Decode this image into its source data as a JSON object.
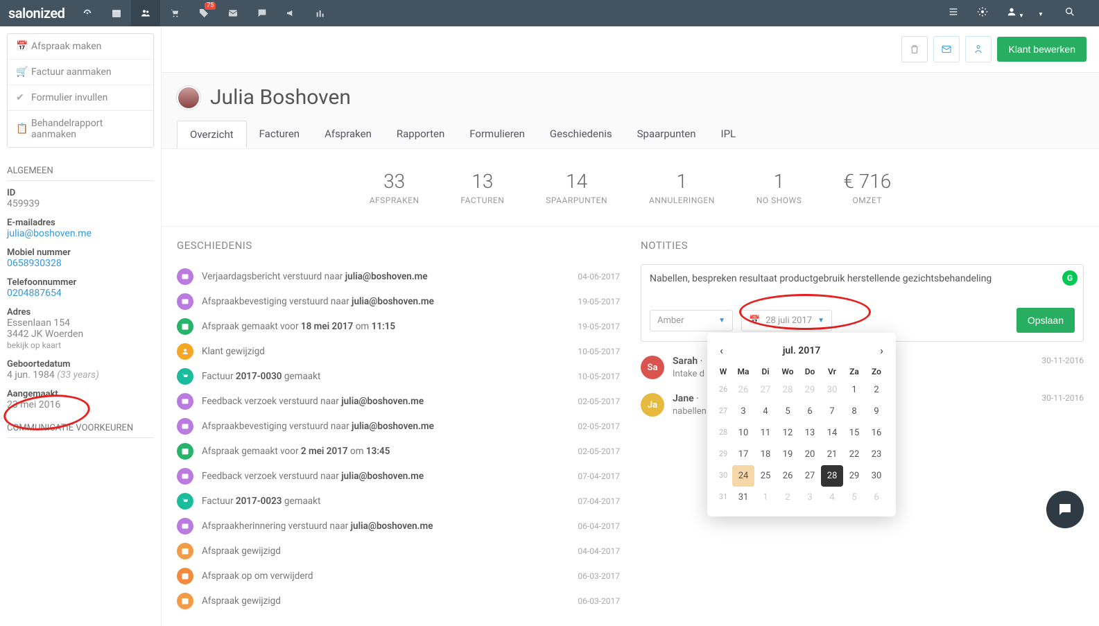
{
  "topnav": {
    "logo": "salonized",
    "tag_badge": "75"
  },
  "actionbar": {
    "edit_label": "Klant bewerken"
  },
  "sidebar": {
    "actions": [
      "Afspraak maken",
      "Factuur aanmaken",
      "Formulier invullen",
      "Behandelrapport aanmaken"
    ],
    "section_general": "ALGEMEEN",
    "id_label": "ID",
    "id_value": "459939",
    "email_label": "E-mailadres",
    "email_value": "julia@boshoven.me",
    "mobile_label": "Mobiel nummer",
    "mobile_value": "0658930328",
    "phone_label": "Telefoonnummer",
    "phone_value": "0204887654",
    "address_label": "Adres",
    "address_line1": "Essenlaan 154",
    "address_line2": "3442 JK Woerden",
    "address_map": "bekijk op kaart",
    "dob_label": "Geboortedatum",
    "dob_value": "4 jun. 1984",
    "dob_age": "(33 years)",
    "created_label": "Aangemaakt",
    "created_value": "23 mei 2016",
    "section_comm": "COMMUNICATIE VOORKEUREN"
  },
  "client": {
    "name": "Julia Boshoven"
  },
  "tabs": [
    "Overzicht",
    "Facturen",
    "Afspraken",
    "Rapporten",
    "Formulieren",
    "Geschiedenis",
    "Spaarpunten",
    "IPL"
  ],
  "stats": [
    {
      "val": "33",
      "lbl": "AFSPRAKEN"
    },
    {
      "val": "13",
      "lbl": "FACTUREN"
    },
    {
      "val": "14",
      "lbl": "SPAARPUNTEN"
    },
    {
      "val": "1",
      "lbl": "ANNULERINGEN"
    },
    {
      "val": "1",
      "lbl": "NO SHOWS"
    },
    {
      "val": "€ 716",
      "lbl": "OMZET"
    }
  ],
  "history": {
    "title": "GESCHIEDENIS",
    "items": [
      {
        "icon": "mail",
        "color": "hi-purple",
        "html": "Verjaardagsbericht verstuurd naar <b>julia@boshoven.me</b>",
        "date": "04-06-2017"
      },
      {
        "icon": "mail",
        "color": "hi-purple",
        "html": "Afspraakbevestiging verstuurd naar <b>julia@boshoven.me</b>",
        "date": "19-05-2017"
      },
      {
        "icon": "cal",
        "color": "hi-green",
        "html": "Afspraak gemaakt voor <b>18 mei 2017</b> om <b>11:15</b>",
        "date": "19-05-2017"
      },
      {
        "icon": "user",
        "color": "hi-orange",
        "html": "Klant gewijzigd",
        "date": "10-05-2017"
      },
      {
        "icon": "cart",
        "color": "hi-teal",
        "html": "Factuur <b>2017-0030</b> gemaakt",
        "date": "10-05-2017"
      },
      {
        "icon": "mail",
        "color": "hi-purple",
        "html": "Feedback verzoek verstuurd naar <b>julia@boshoven.me</b>",
        "date": "02-05-2017"
      },
      {
        "icon": "mail",
        "color": "hi-purple",
        "html": "Afspraakbevestiging verstuurd naar <b>julia@boshoven.me</b>",
        "date": "02-05-2017"
      },
      {
        "icon": "cal",
        "color": "hi-green",
        "html": "Afspraak gemaakt voor <b>2 mei 2017</b> om <b>13:45</b>",
        "date": "02-05-2017"
      },
      {
        "icon": "mail",
        "color": "hi-purple",
        "html": "Feedback verzoek verstuurd naar <b>julia@boshoven.me</b>",
        "date": "07-04-2017"
      },
      {
        "icon": "cart",
        "color": "hi-teal",
        "html": "Factuur <b>2017-0023</b> gemaakt",
        "date": "07-04-2017"
      },
      {
        "icon": "mail",
        "color": "hi-purple",
        "html": "Afspraakherinnering verstuurd naar <b>julia@boshoven.me</b>",
        "date": "06-04-2017"
      },
      {
        "icon": "cal",
        "color": "hi-orange2",
        "html": "Afspraak gewijzigd",
        "date": "04-04-2017"
      },
      {
        "icon": "cal",
        "color": "hi-orange3",
        "html": "Afspraak op om verwijderd",
        "date": "06-03-2017"
      },
      {
        "icon": "cal",
        "color": "hi-orange2",
        "html": "Afspraak gewijzigd",
        "date": "06-03-2017"
      }
    ]
  },
  "notes": {
    "title": "NOTITIES",
    "draft": "Nabellen, bespreken resultaat productgebruik herstellende gezichtsbehandeling",
    "assignee": "Amber",
    "date_label": "28 juli 2017",
    "save_label": "Opslaan",
    "items": [
      {
        "initials": "Sa",
        "color": "na-red",
        "author": "Sarah",
        "msg": "Intake d",
        "date": "30-11-2016"
      },
      {
        "initials": "Ja",
        "color": "na-yellow",
        "author": "Jane",
        "msg": "nabellen",
        "date": "30-11-2016"
      }
    ]
  },
  "datepicker": {
    "title": "jul. 2017",
    "dow_header": "W",
    "dow": [
      "Ma",
      "Di",
      "Wo",
      "Do",
      "Vr",
      "Za",
      "Zo"
    ],
    "weeks": [
      {
        "wk": "26",
        "days": [
          {
            "d": "26",
            "m": true
          },
          {
            "d": "27",
            "m": true
          },
          {
            "d": "28",
            "m": true
          },
          {
            "d": "29",
            "m": true
          },
          {
            "d": "30",
            "m": true
          },
          {
            "d": "1"
          },
          {
            "d": "2"
          }
        ]
      },
      {
        "wk": "27",
        "days": [
          {
            "d": "3"
          },
          {
            "d": "4"
          },
          {
            "d": "5"
          },
          {
            "d": "6"
          },
          {
            "d": "7"
          },
          {
            "d": "8"
          },
          {
            "d": "9"
          }
        ]
      },
      {
        "wk": "28",
        "days": [
          {
            "d": "10"
          },
          {
            "d": "11"
          },
          {
            "d": "12"
          },
          {
            "d": "13"
          },
          {
            "d": "14"
          },
          {
            "d": "15"
          },
          {
            "d": "16"
          }
        ]
      },
      {
        "wk": "29",
        "days": [
          {
            "d": "17"
          },
          {
            "d": "18"
          },
          {
            "d": "19"
          },
          {
            "d": "20"
          },
          {
            "d": "21"
          },
          {
            "d": "22"
          },
          {
            "d": "23"
          }
        ]
      },
      {
        "wk": "30",
        "days": [
          {
            "d": "24",
            "today": true
          },
          {
            "d": "25"
          },
          {
            "d": "26"
          },
          {
            "d": "27"
          },
          {
            "d": "28",
            "sel": true
          },
          {
            "d": "29"
          },
          {
            "d": "30"
          }
        ]
      },
      {
        "wk": "31",
        "days": [
          {
            "d": "31"
          },
          {
            "d": "1",
            "m": true
          },
          {
            "d": "2",
            "m": true
          },
          {
            "d": "3",
            "m": true
          },
          {
            "d": "4",
            "m": true
          },
          {
            "d": "5",
            "m": true
          },
          {
            "d": "6",
            "m": true
          }
        ]
      }
    ]
  }
}
